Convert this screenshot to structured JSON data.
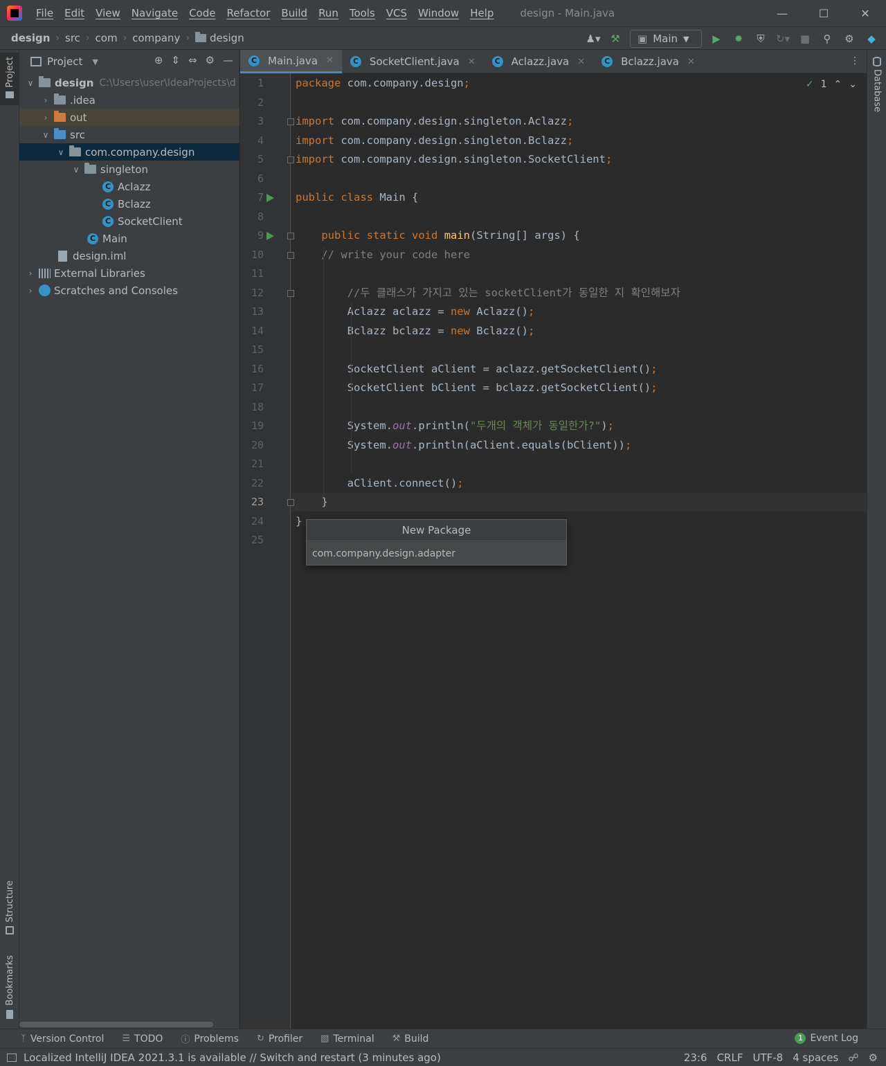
{
  "window": {
    "title": "design - Main.java",
    "menu": [
      "File",
      "Edit",
      "View",
      "Navigate",
      "Code",
      "Refactor",
      "Build",
      "Run",
      "Tools",
      "VCS",
      "Window",
      "Help"
    ]
  },
  "breadcrumbs": [
    "design",
    "src",
    "com",
    "company",
    "design"
  ],
  "toolbar": {
    "run_config": "Main"
  },
  "project_panel": {
    "title": "Project",
    "root_path": "C:\\Users\\user\\IdeaProjects\\d",
    "tree": [
      {
        "label": "design"
      },
      {
        "label": ".idea"
      },
      {
        "label": "out"
      },
      {
        "label": "src"
      },
      {
        "label": "com.company.design"
      },
      {
        "label": "singleton"
      },
      {
        "label": "Aclazz"
      },
      {
        "label": "Bclazz"
      },
      {
        "label": "SocketClient"
      },
      {
        "label": "Main"
      },
      {
        "label": "design.iml"
      },
      {
        "label": "External Libraries"
      },
      {
        "label": "Scratches and Consoles"
      }
    ]
  },
  "tabs": [
    "Main.java",
    "SocketClient.java",
    "Aclazz.java",
    "Bclazz.java"
  ],
  "editor": {
    "inspection_count": "1",
    "current_line": 23,
    "line_numbers": [
      "1",
      "2",
      "3",
      "4",
      "5",
      "6",
      "7",
      "8",
      "9",
      "10",
      "11",
      "12",
      "13",
      "14",
      "15",
      "16",
      "17",
      "18",
      "19",
      "20",
      "21",
      "22",
      "23",
      "24",
      "25"
    ],
    "code": [
      "package com.company.design;",
      "",
      "import com.company.design.singleton.Aclazz;",
      "import com.company.design.singleton.Bclazz;",
      "import com.company.design.singleton.SocketClient;",
      "",
      "public class Main {",
      "",
      "    public static void main(String[] args) {",
      "    // write your code here",
      "",
      "        //두 클래스가 가지고 있는 socketClient가 동일한 지 확인해보자",
      "        Aclazz aclazz = new Aclazz();",
      "        Bclazz bclazz = new Bclazz();",
      "",
      "        SocketClient aClient = aclazz.getSocketClient();",
      "        SocketClient bClient = bclazz.getSocketClient();",
      "",
      "        System.out.println(\"두개의 객체가 동일한가?\");",
      "        System.out.println(aClient.equals(bClient));",
      "",
      "        aClient.connect();",
      "    }",
      "}",
      ""
    ]
  },
  "new_package_dialog": {
    "title": "New Package",
    "value": "com.company.design.adapter"
  },
  "right_stripe": {
    "database": "Database"
  },
  "left_stripe": {
    "project": "Project",
    "structure": "Structure",
    "bookmarks": "Bookmarks"
  },
  "bottom_tools": [
    "Version Control",
    "TODO",
    "Problems",
    "Profiler",
    "Terminal",
    "Build"
  ],
  "event_log": {
    "label": "Event Log",
    "count": "1"
  },
  "status": {
    "message": "Localized IntelliJ IDEA 2021.3.1 is available // Switch and restart (3 minutes ago)",
    "position": "23:6",
    "line_sep": "CRLF",
    "encoding": "UTF-8",
    "indent": "4 spaces"
  }
}
